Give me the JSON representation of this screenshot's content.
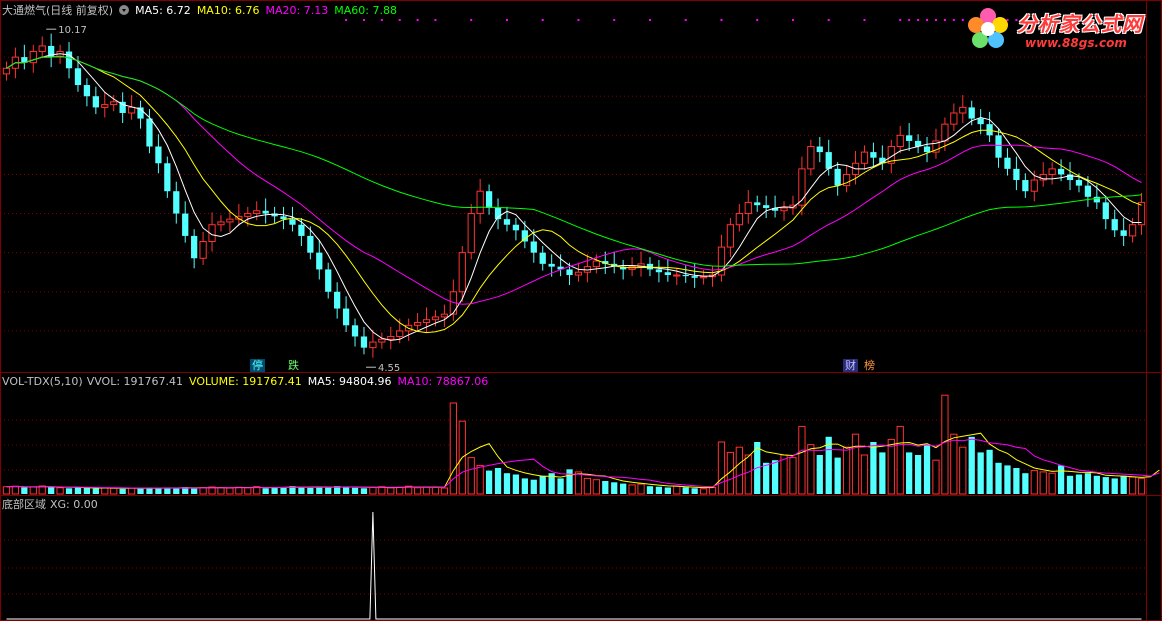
{
  "header": {
    "stock_name": "大通燃气(日线 前复权)",
    "ma5": "MA5: 6.72",
    "ma10": "MA10: 6.76",
    "ma20": "MA20: 7.13",
    "ma60": "MA60: 7.88"
  },
  "vol_header": {
    "title": "VOL-TDX(5,10)",
    "vvol": "VVOL: 191767.41",
    "volume": "VOLUME: 191767.41",
    "ma5": "MA5: 94804.96",
    "ma10": "MA10: 78867.06"
  },
  "xg_header": {
    "title": "底部区域",
    "xg": "XG: 0.00"
  },
  "logo": {
    "text": "分析家公式网",
    "url": "www.88gs.com"
  },
  "flags": {
    "ting": "停",
    "die": "跌",
    "cai": "财",
    "bang": "榜"
  },
  "colors": {
    "up": "#ff3232",
    "down": "#54ffff",
    "ma5": "#ffffff",
    "ma10": "#ffff00",
    "ma20": "#ff00ff",
    "ma60": "#00ff00",
    "grid": "#800000",
    "text": "#c0c0c0"
  },
  "chart_data": [
    {
      "type": "candlestick",
      "annotations": {
        "high_label": "10.17",
        "low_label": "4.55"
      },
      "ylim": [
        4.2,
        10.5
      ],
      "close": [
        9.6,
        9.8,
        9.7,
        9.9,
        10.0,
        9.8,
        9.9,
        9.6,
        9.3,
        9.1,
        8.9,
        8.95,
        9.0,
        8.8,
        8.9,
        8.7,
        8.2,
        7.9,
        7.4,
        7.0,
        6.6,
        6.2,
        6.5,
        6.8,
        6.85,
        6.9,
        6.95,
        7.0,
        7.05,
        7.0,
        6.95,
        6.9,
        6.8,
        6.6,
        6.3,
        6.0,
        5.6,
        5.3,
        5.0,
        4.8,
        4.6,
        4.7,
        4.75,
        4.8,
        4.9,
        5.0,
        5.05,
        5.1,
        5.15,
        5.2,
        5.6,
        6.3,
        7.0,
        7.4,
        7.1,
        6.9,
        6.8,
        6.7,
        6.5,
        6.3,
        6.1,
        6.05,
        6.0,
        5.9,
        5.95,
        6.05,
        6.15,
        6.1,
        6.05,
        6.0,
        6.05,
        6.1,
        6.0,
        5.95,
        5.9,
        5.9,
        5.88,
        5.85,
        5.87,
        5.9,
        6.4,
        6.8,
        7.0,
        7.2,
        7.15,
        7.1,
        7.05,
        7.1,
        7.15,
        7.8,
        8.2,
        8.1,
        7.8,
        7.5,
        7.7,
        7.9,
        8.1,
        8.0,
        7.9,
        8.2,
        8.4,
        8.3,
        8.2,
        8.1,
        8.3,
        8.6,
        8.8,
        8.9,
        8.7,
        8.6,
        8.4,
        8.0,
        7.8,
        7.6,
        7.4,
        7.6,
        7.7,
        7.8,
        7.7,
        7.6,
        7.5,
        7.3,
        7.2,
        6.9,
        6.7,
        6.6,
        6.8,
        7.2
      ],
      "volume_ylim": [
        0,
        400000
      ],
      "volume": [
        28000,
        30000,
        25000,
        27000,
        31000,
        26000,
        24000,
        22000,
        25000,
        23000,
        21000,
        24000,
        22000,
        20000,
        23000,
        21000,
        24000,
        22000,
        25000,
        23000,
        26000,
        21000,
        24000,
        27000,
        25000,
        23000,
        26000,
        24000,
        28000,
        22000,
        25000,
        27000,
        30000,
        26000,
        24000,
        28000,
        25000,
        30000,
        27000,
        24000,
        22000,
        25000,
        28000,
        24000,
        26000,
        30000,
        24000,
        27000,
        25000,
        23000,
        350000,
        280000,
        140000,
        110000,
        90000,
        100000,
        80000,
        75000,
        60000,
        55000,
        70000,
        80000,
        60000,
        95000,
        85000,
        60000,
        55000,
        50000,
        45000,
        40000,
        35000,
        38000,
        30000,
        28000,
        25000,
        30000,
        26000,
        22000,
        20000,
        25000,
        200000,
        160000,
        180000,
        150000,
        200000,
        120000,
        130000,
        150000,
        140000,
        260000,
        190000,
        150000,
        220000,
        140000,
        180000,
        230000,
        150000,
        200000,
        160000,
        210000,
        260000,
        160000,
        150000,
        190000,
        130000,
        380000,
        230000,
        180000,
        220000,
        160000,
        170000,
        120000,
        110000,
        100000,
        80000,
        90000,
        85000,
        80000,
        110000,
        70000,
        75000,
        80000,
        70000,
        65000,
        60000,
        70000,
        65000,
        60000,
        75000,
        191767
      ],
      "xg_ylim": [
        0,
        1
      ],
      "xg": [
        0,
        0,
        0,
        0,
        0,
        0,
        0,
        0,
        0,
        0,
        0,
        0,
        0,
        0,
        0,
        0,
        0,
        0,
        0,
        0,
        0,
        0,
        0,
        0,
        0,
        0,
        0,
        0,
        0,
        0,
        0,
        0,
        0,
        0,
        0,
        0,
        0,
        0,
        0,
        0,
        0,
        1,
        0,
        0,
        0,
        0,
        0,
        0,
        0,
        0,
        0,
        0,
        0,
        0,
        0,
        0,
        0,
        0,
        0,
        0,
        0,
        0,
        0,
        0,
        0,
        0,
        0,
        0,
        0,
        0,
        0,
        0,
        0,
        0,
        0,
        0,
        0,
        0,
        0,
        0,
        0,
        0,
        0,
        0,
        0,
        0,
        0,
        0,
        0,
        0,
        0,
        0,
        0,
        0,
        0,
        0,
        0,
        0,
        0,
        0,
        0,
        0,
        0,
        0,
        0,
        0,
        0,
        0,
        0,
        0,
        0,
        0,
        0,
        0,
        0,
        0,
        0,
        0,
        0,
        0,
        0,
        0,
        0,
        0,
        0,
        0,
        0,
        0,
        0,
        0
      ]
    }
  ]
}
